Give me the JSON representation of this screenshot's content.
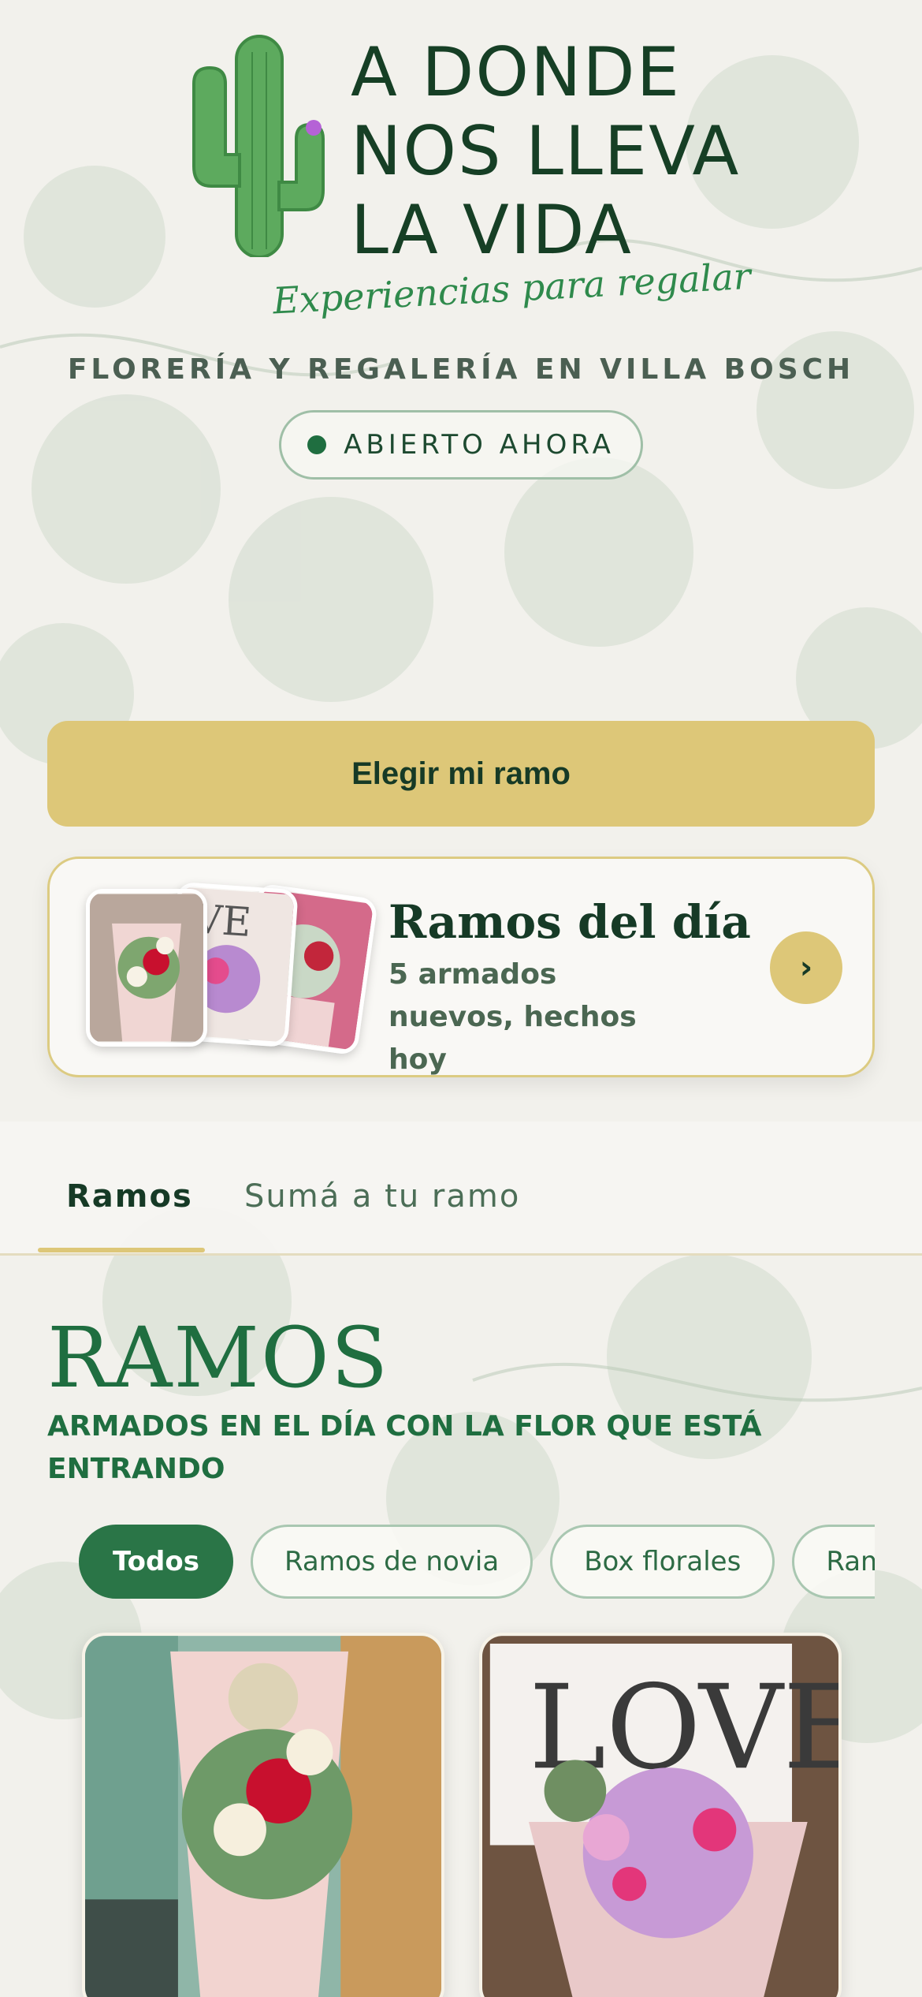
{
  "header": {
    "logo_icon": "cactus-icon",
    "brand_lines": [
      "A DONDE",
      "NOS LLEVA",
      "LA VIDA"
    ],
    "tagline": "Experiencias para regalar",
    "subtitle": "FLORERÍA Y REGALERÍA EN VILLA BOSCH",
    "status": "ABIERTO AHORA",
    "status_color": "#1f6e40"
  },
  "cta": {
    "label": "Elegir mi ramo"
  },
  "day_card": {
    "title": "Ramos del día",
    "subtitle": "5 armados nuevos, hechos hoy",
    "arrow": "›"
  },
  "tabs": [
    {
      "label": "Ramos",
      "active": true
    },
    {
      "label": "Sumá a tu ramo",
      "active": false
    }
  ],
  "section": {
    "title": "RAMOS",
    "subtitle": "ARMADOS EN EL DÍA CON LA FLOR QUE ESTÁ ENTRANDO"
  },
  "chips": [
    {
      "label": "Todos",
      "active": true
    },
    {
      "label": "Ramos de novia",
      "active": false
    },
    {
      "label": "Box florales",
      "active": false
    },
    {
      "label": "Ramos",
      "active": false
    }
  ],
  "colors": {
    "brand_green": "#1f6e40",
    "gold": "#ddc778",
    "background": "#f2f1ec"
  }
}
